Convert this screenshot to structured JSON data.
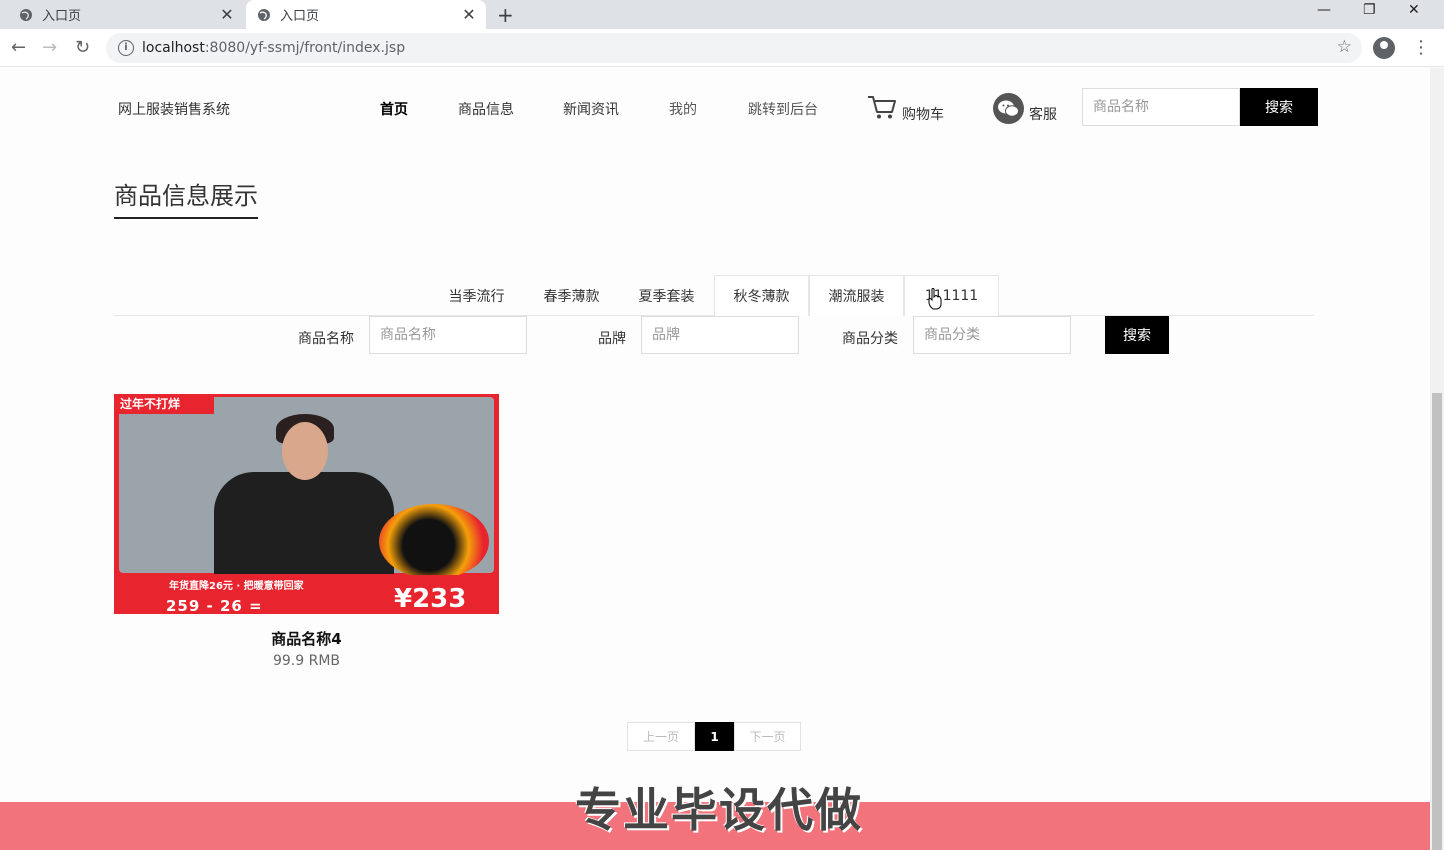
{
  "browser": {
    "tabs": [
      {
        "title": "入口页",
        "active": false
      },
      {
        "title": "入口页",
        "active": true
      }
    ],
    "new_tab": "+",
    "close_glyph": "✕",
    "url_host": "localhost",
    "url_path": ":8080/yf-ssmj/front/index.jsp",
    "window_controls": {
      "minimize": "—",
      "restore": "❐",
      "close": "✕"
    }
  },
  "header": {
    "site_name": "网上服装销售系统",
    "nav": [
      "首页",
      "商品信息",
      "新闻资讯",
      "我的",
      "跳转到后台"
    ],
    "cart_label": "购物车",
    "service_label": "客服",
    "search_placeholder": "商品名称",
    "search_button": "搜索"
  },
  "section": {
    "title": "商品信息展示"
  },
  "category_tabs": [
    "当季流行",
    "春季薄款",
    "夏季套装",
    "秋冬薄款",
    "潮流服装",
    "111111"
  ],
  "filters": {
    "name_label": "商品名称",
    "name_placeholder": "商品名称",
    "brand_label": "品牌",
    "brand_placeholder": "品牌",
    "category_label": "商品分类",
    "category_placeholder": "商品分类",
    "button": "搜索"
  },
  "products": [
    {
      "name": "商品名称4",
      "price": "99.9 RMB",
      "image_texts": {
        "banner": "过年不打烊",
        "strip": "年货直降26元 · 把暖意带回家",
        "price_row": "259  -  26  =",
        "price_tag": "¥233"
      }
    }
  ],
  "pagination": {
    "prev": "上一页",
    "current": "1",
    "next": "下一页"
  },
  "watermark": "专业毕设代做",
  "colors": {
    "accent": "#000000",
    "footer": "#f2737c",
    "product_bg": "#e8242e"
  }
}
